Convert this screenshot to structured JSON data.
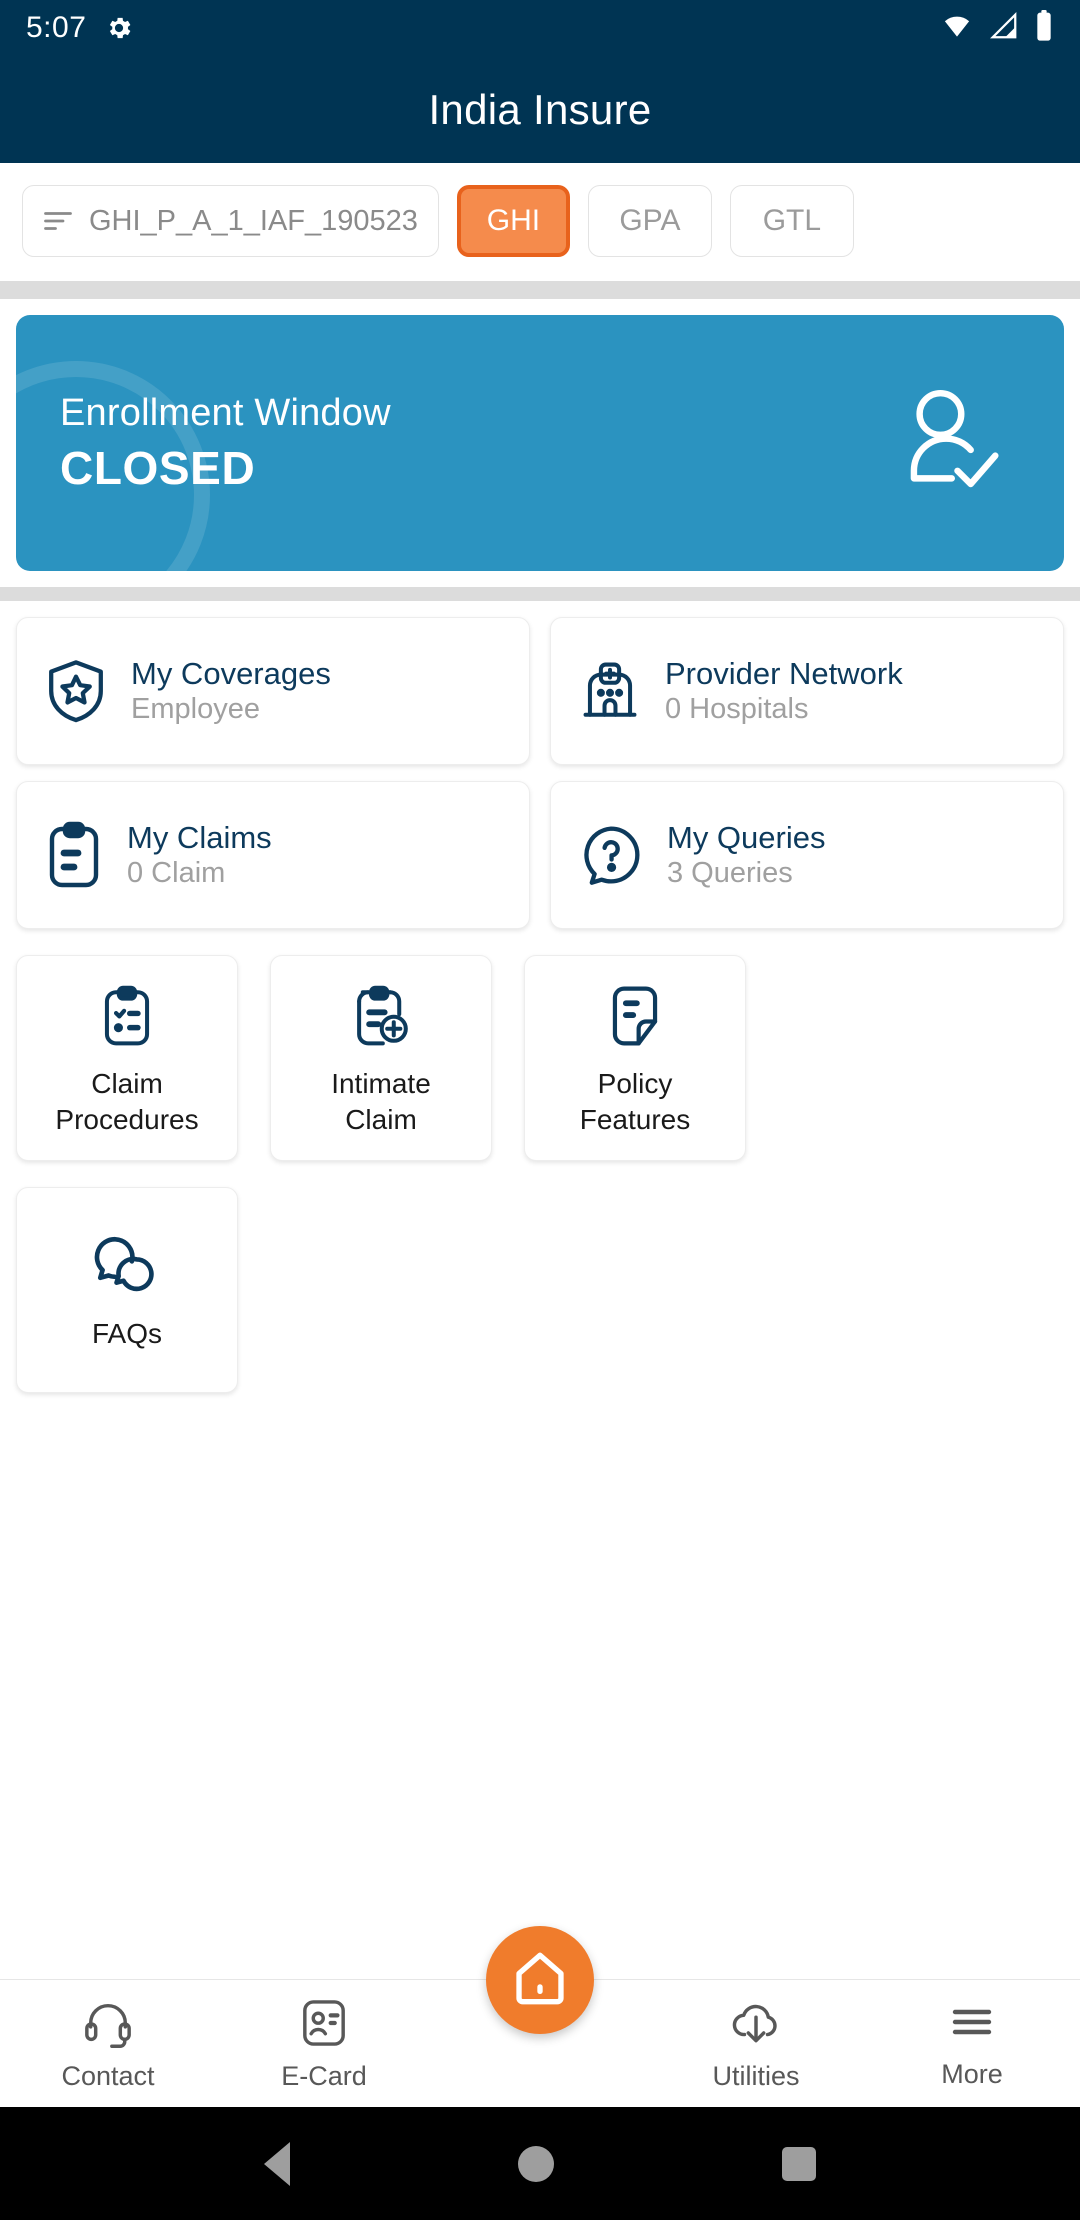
{
  "status_bar": {
    "time": "5:07",
    "icons": [
      "gear-icon",
      "wifi-icon",
      "signal-icon",
      "battery-icon"
    ]
  },
  "app_bar": {
    "title": "India Insure"
  },
  "filter_row": {
    "policy_selector": {
      "icon": "filter-icon",
      "value": "GHI_P_A_1_IAF_190523"
    },
    "chips": [
      {
        "label": "GHI",
        "selected": true
      },
      {
        "label": "GPA",
        "selected": false
      },
      {
        "label": "GTL",
        "selected": false
      }
    ]
  },
  "banner": {
    "line1": "Enrollment Window",
    "line2": "CLOSED",
    "icon": "person-check-icon",
    "background_color": "#2b93c0"
  },
  "info_cards": [
    {
      "title": "My Coverages",
      "subtitle": "Employee",
      "icon": "shield-star-icon"
    },
    {
      "title": "Provider Network",
      "subtitle": "0 Hospitals",
      "icon": "hospital-icon"
    },
    {
      "title": "My Claims",
      "subtitle": "0 Claim",
      "icon": "clipboard-icon"
    },
    {
      "title": "My Queries",
      "subtitle": "3 Queries",
      "icon": "question-bubble-icon"
    }
  ],
  "action_tiles": [
    {
      "line1": "Claim",
      "line2": "Procedures",
      "icon": "checklist-clipboard-icon"
    },
    {
      "line1": "Intimate",
      "line2": "Claim",
      "icon": "clipboard-plus-icon"
    },
    {
      "line1": "Policy",
      "line2": "Features",
      "icon": "document-fold-icon"
    },
    {
      "line1": "FAQs",
      "line2": "",
      "icon": "chat-bubbles-icon"
    }
  ],
  "bottom_nav": {
    "items": [
      {
        "label": "Contact",
        "icon": "headset-icon"
      },
      {
        "label": "E-Card",
        "icon": "id-card-icon"
      },
      {
        "label": "Utilities",
        "icon": "cloud-download-icon"
      },
      {
        "label": "More",
        "icon": "hamburger-icon"
      }
    ],
    "fab": {
      "icon": "home-icon",
      "color": "#f07c2c"
    }
  },
  "android_nav": {
    "back": "back-triangle-icon",
    "home": "home-circle-icon",
    "recents": "recents-square-icon"
  },
  "theme": {
    "navy": "#003453",
    "card_navy": "#0d3a5c",
    "orange": "#f07c2c",
    "chip_orange": "#f58b4c",
    "chip_orange_border": "#e8621c",
    "banner_blue": "#2b93c0",
    "muted_gray": "#a0a0a0"
  }
}
